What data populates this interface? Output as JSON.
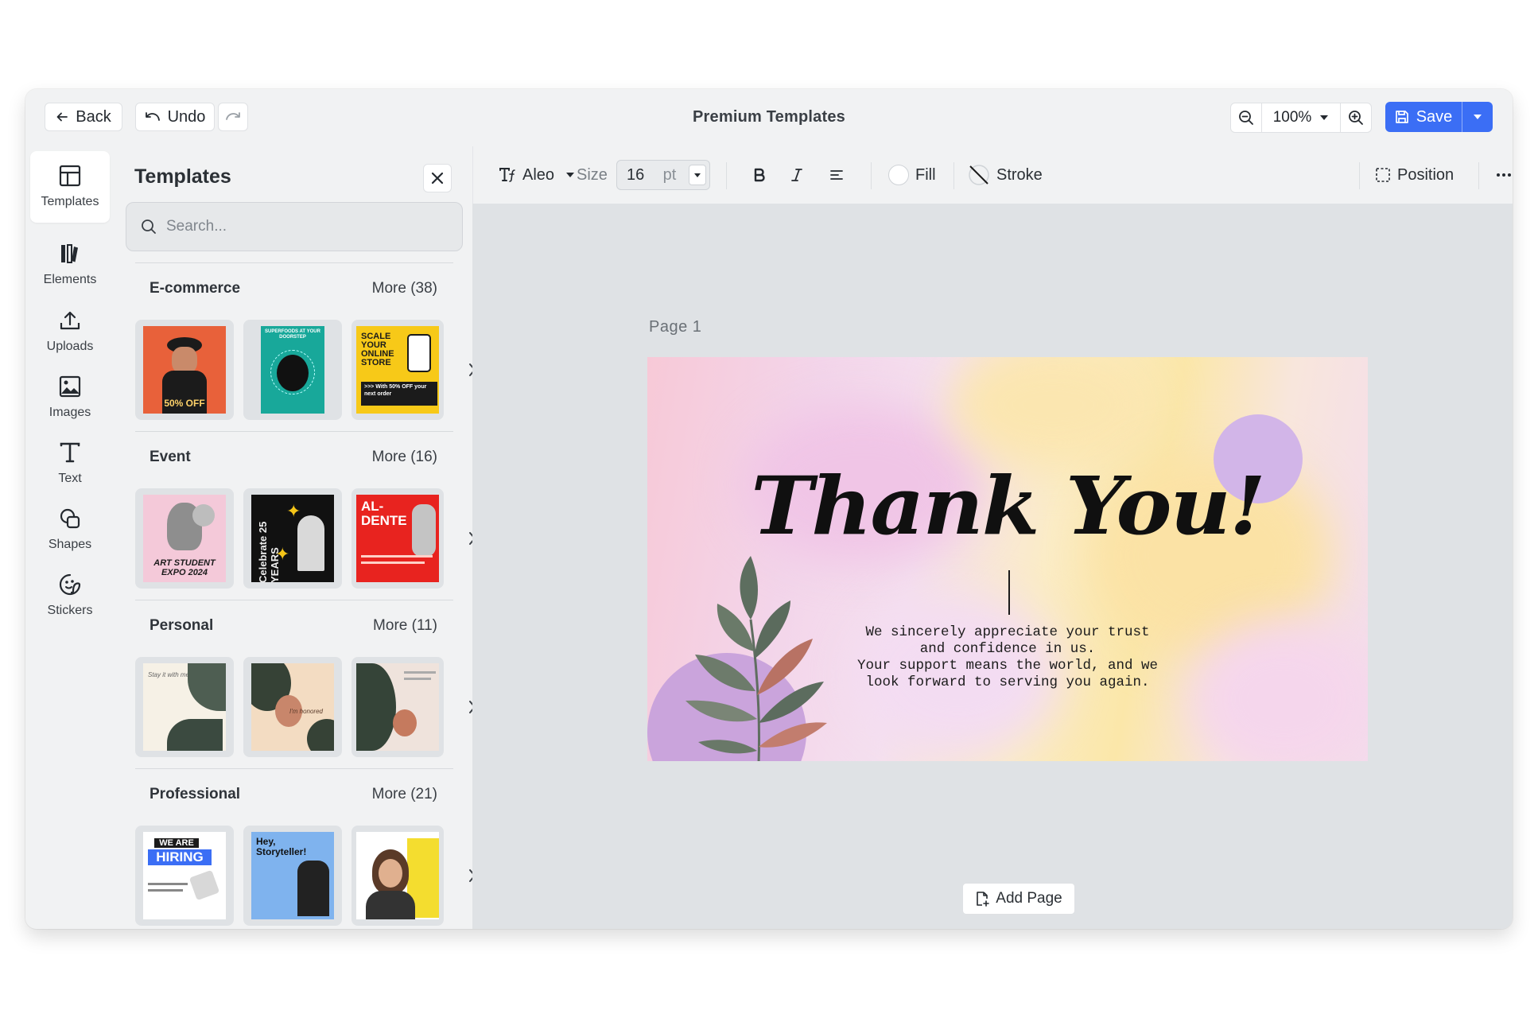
{
  "topbar": {
    "back_label": "Back",
    "undo_label": "Undo",
    "title": "Premium Templates",
    "zoom_value": "100%",
    "save_label": "Save",
    "accent_color": "#3b6ef5"
  },
  "rail": {
    "items": [
      {
        "label": "Templates",
        "icon": "layout-icon"
      },
      {
        "label": "Elements",
        "icon": "elements-icon"
      },
      {
        "label": "Uploads",
        "icon": "upload-icon"
      },
      {
        "label": "Images",
        "icon": "image-icon"
      },
      {
        "label": "Text",
        "icon": "text-icon"
      },
      {
        "label": "Shapes",
        "icon": "shapes-icon"
      },
      {
        "label": "Stickers",
        "icon": "sticker-icon"
      }
    ]
  },
  "panel": {
    "title": "Templates",
    "search_placeholder": "Search...",
    "categories": [
      {
        "name": "E-commerce",
        "more": "More (38)",
        "thumbs": [
          {
            "text": "50% OFF"
          },
          {
            "text": "SUPERFOODS AT YOUR DOORSTEP"
          },
          {
            "text": "SCALE YOUR ONLINE STORE",
            "sub": ">>> With 50% OFF your next order"
          }
        ]
      },
      {
        "name": "Event",
        "more": "More (16)",
        "thumbs": [
          {
            "text": "ART STUDENT EXPO 2024"
          },
          {
            "text": "Celebrate 25 YEARS"
          },
          {
            "text": "AL- DENTE"
          }
        ]
      },
      {
        "name": "Personal",
        "more": "More (11)",
        "thumbs": [
          {
            "text": "Stay it with me"
          },
          {
            "text": "I'm honored"
          },
          {
            "text": ""
          }
        ]
      },
      {
        "name": "Professional",
        "more": "More (21)",
        "thumbs": [
          {
            "text": "WE ARE",
            "sub": "HIRING"
          },
          {
            "text": "Hey, Storyteller!"
          },
          {
            "text": ""
          }
        ]
      }
    ]
  },
  "toolbar": {
    "font_name": "Aleo",
    "size_label": "Size",
    "size_value": "16",
    "size_unit": "pt",
    "fill_label": "Fill",
    "stroke_label": "Stroke",
    "position_label": "Position"
  },
  "canvas": {
    "page_label": "Page  1",
    "heading": "Thank You!",
    "message_lines": [
      "We sincerely appreciate your trust",
      "and confidence in us.",
      "Your support means the world, and we",
      "look forward to serving you again."
    ],
    "add_page_label": "Add Page"
  }
}
